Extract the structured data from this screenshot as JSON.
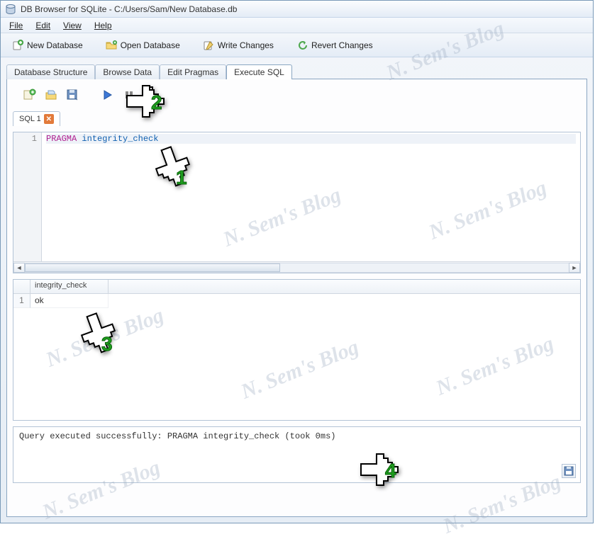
{
  "window": {
    "title": "DB Browser for SQLite - C:/Users/Sam/New Database.db"
  },
  "menu": {
    "file": "File",
    "edit": "Edit",
    "view": "View",
    "help": "Help"
  },
  "toolbar": {
    "new_db": "New Database",
    "open_db": "Open Database",
    "write_changes": "Write Changes",
    "revert_changes": "Revert Changes"
  },
  "tabs": {
    "structure": "Database Structure",
    "browse": "Browse Data",
    "pragmas": "Edit Pragmas",
    "execute": "Execute SQL"
  },
  "sql_tab": {
    "label": "SQL 1"
  },
  "editor": {
    "line_number": "1",
    "keyword1": "PRAGMA",
    "keyword2": "integrity_check"
  },
  "result": {
    "column1": "integrity_check",
    "row1_num": "1",
    "row1_val": "ok"
  },
  "status": {
    "message": "Query executed successfully: PRAGMA integrity_check (took 0ms)"
  },
  "watermark": "N. Sem's Blog",
  "annotations": {
    "a1": "1",
    "a2": "2",
    "a3": "3",
    "a4": "4"
  }
}
